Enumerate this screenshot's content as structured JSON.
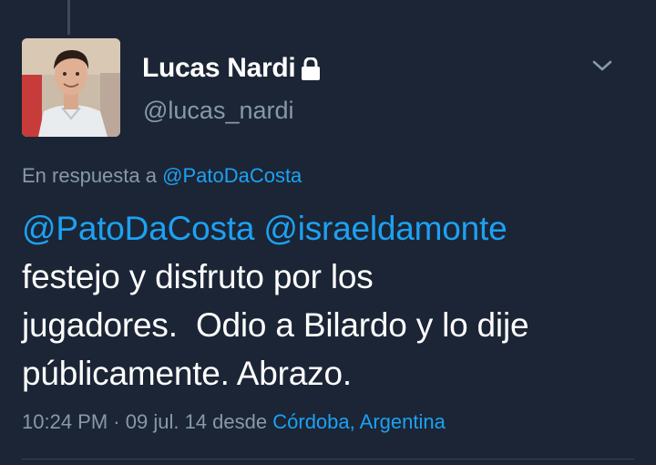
{
  "colors": {
    "background": "#1b2535",
    "text": "#ffffff",
    "secondary_text": "#8899a6",
    "link": "#1da1f2"
  },
  "author": {
    "display_name": "Lucas Nardi",
    "handle": "@lucas_nardi",
    "protected_icon": "lock-icon",
    "avatar_icon": "profile-photo"
  },
  "menu": {
    "icon": "chevron-down-icon"
  },
  "reply": {
    "prefix": "En respuesta a",
    "mention": "@PatoDaCosta"
  },
  "tweet": {
    "mention_1": "@PatoDaCosta",
    "mention_2": "@israeldamonte",
    "body_line_1": "festejo y disfruto por los",
    "body_line_2": "jugadores.  Odio a Bilardo y lo dije",
    "body_line_3": "públicamente. Abrazo."
  },
  "meta": {
    "time": "10:24 PM",
    "separator": "·",
    "date": "09 jul. 14",
    "from_label": "desde",
    "location": "Córdoba, Argentina"
  }
}
